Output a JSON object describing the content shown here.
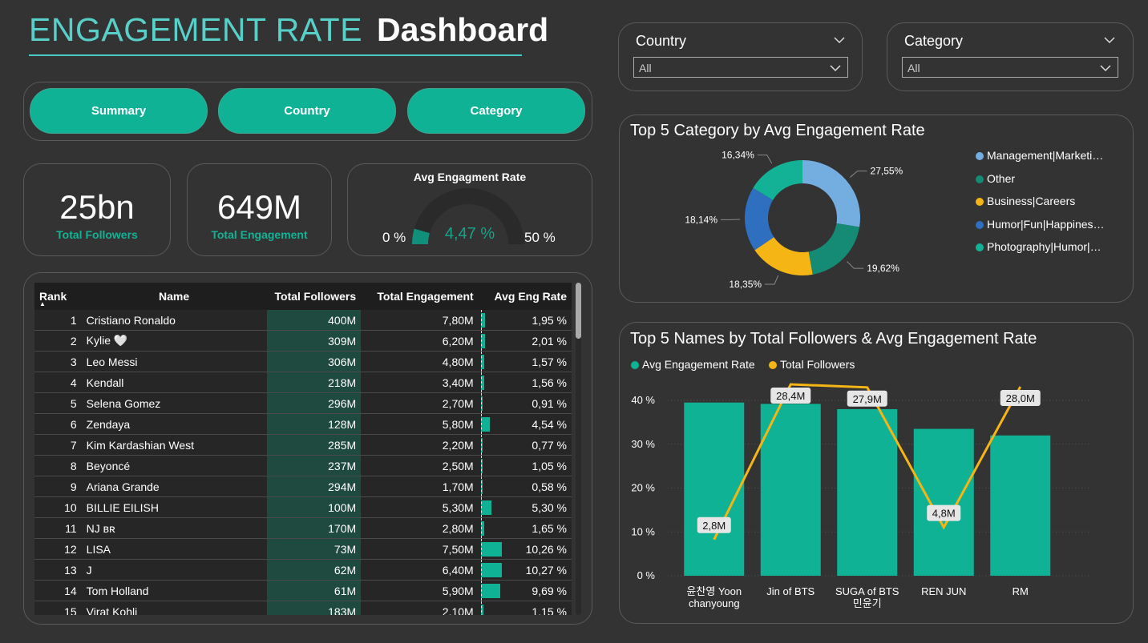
{
  "header": {
    "title_light": "ENGAGEMENT RATE",
    "title_bold": "Dashboard"
  },
  "nav": {
    "summary": "Summary",
    "country": "Country",
    "category": "Category"
  },
  "kpis": {
    "followers_value": "25bn",
    "followers_label": "Total Followers",
    "engagement_value": "649M",
    "engagement_label": "Total Engagement"
  },
  "gauge": {
    "title": "Avg Engagment Rate",
    "min_label": "0 %",
    "max_label": "50 %",
    "value_label": "4,47 %",
    "fraction": 0.0894
  },
  "slicers": {
    "country": {
      "label": "Country",
      "value": "All"
    },
    "category": {
      "label": "Category",
      "value": "All"
    }
  },
  "table": {
    "headers": {
      "rank": "Rank",
      "name": "Name",
      "followers": "Total Followers",
      "engagement": "Total Engagement",
      "avg": "Avg Eng Rate"
    },
    "rows": [
      {
        "rank": "1",
        "name": "Cristiano Ronaldo",
        "followers": "400M",
        "engagement": "7,80M",
        "avg": "1,95 %",
        "v": 1.95
      },
      {
        "rank": "2",
        "name": "Kylie 🤍",
        "followers": "309M",
        "engagement": "6,20M",
        "avg": "2,01 %",
        "v": 2.01
      },
      {
        "rank": "3",
        "name": "Leo Messi",
        "followers": "306M",
        "engagement": "4,80M",
        "avg": "1,57 %",
        "v": 1.57
      },
      {
        "rank": "4",
        "name": "Kendall",
        "followers": "218M",
        "engagement": "3,40M",
        "avg": "1,56 %",
        "v": 1.56
      },
      {
        "rank": "5",
        "name": "Selena Gomez",
        "followers": "296M",
        "engagement": "2,70M",
        "avg": "0,91 %",
        "v": 0.91
      },
      {
        "rank": "6",
        "name": "Zendaya",
        "followers": "128M",
        "engagement": "5,80M",
        "avg": "4,54 %",
        "v": 4.54
      },
      {
        "rank": "7",
        "name": "Kim Kardashian West",
        "followers": "285M",
        "engagement": "2,20M",
        "avg": "0,77 %",
        "v": 0.77
      },
      {
        "rank": "8",
        "name": "Beyoncé",
        "followers": "237M",
        "engagement": "2,50M",
        "avg": "1,05 %",
        "v": 1.05
      },
      {
        "rank": "9",
        "name": "Ariana Grande",
        "followers": "294M",
        "engagement": "1,70M",
        "avg": "0,58 %",
        "v": 0.58
      },
      {
        "rank": "10",
        "name": "BILLIE EILISH",
        "followers": "100M",
        "engagement": "5,30M",
        "avg": "5,30 %",
        "v": 5.3
      },
      {
        "rank": "11",
        "name": "NJ ʙʀ",
        "followers": "170M",
        "engagement": "2,80M",
        "avg": "1,65 %",
        "v": 1.65
      },
      {
        "rank": "12",
        "name": "LISA",
        "followers": "73M",
        "engagement": "7,50M",
        "avg": "10,26 %",
        "v": 10.26
      },
      {
        "rank": "13",
        "name": "J",
        "followers": "62M",
        "engagement": "6,40M",
        "avg": "10,27 %",
        "v": 10.27
      },
      {
        "rank": "14",
        "name": "Tom Holland",
        "followers": "61M",
        "engagement": "5,90M",
        "avg": "9,69 %",
        "v": 9.69
      },
      {
        "rank": "15",
        "name": "Virat Kohli",
        "followers": "183M",
        "engagement": "2,10M",
        "avg": "1,15 %",
        "v": 1.15
      }
    ]
  },
  "donut_title": "Top 5 Category by Avg Engagement Rate",
  "combo_title": "Top 5 Names by Total Followers & Avg Engagement Rate",
  "chart_data": [
    {
      "type": "pie",
      "title": "Top 5 Category by Avg Engagement Rate",
      "categories": [
        "Management|Marketi…",
        "Other",
        "Business|Careers",
        "Humor|Fun|Happines…",
        "Photography|Humor|…"
      ],
      "values": [
        27.55,
        19.62,
        18.35,
        18.14,
        16.34
      ],
      "labels": [
        "27,55%",
        "19,62%",
        "18,35%",
        "18,14%",
        "16,34%"
      ],
      "colors": [
        "#74aee0",
        "#158a74",
        "#f5b515",
        "#2f6fc0",
        "#13b296"
      ],
      "legend": "right"
    },
    {
      "type": "bar",
      "title": "Top 5 Names by Total Followers & Avg Engagement Rate",
      "categories": [
        "윤찬영 Yoon chanyoung",
        "Jin of BTS",
        "SUGA of BTS 민윤기",
        "REN JUN",
        "RM"
      ],
      "series": [
        {
          "name": "Avg Engagement Rate",
          "values": [
            39.5,
            39.2,
            38.0,
            33.5,
            32.0
          ],
          "color": "#10b295"
        },
        {
          "name": "Total Followers",
          "values": [
            2.8,
            28.4,
            27.9,
            4.8,
            28.0
          ],
          "value_labels": [
            "2,8M",
            "28,4M",
            "27,9M",
            "4,8M",
            "28,0M"
          ],
          "color": "#f5b515"
        }
      ],
      "yticks": [
        "40 %",
        "30 %",
        "20 %",
        "10 %",
        "0 %"
      ],
      "ylim": [
        0,
        40
      ],
      "legend": "top-left"
    }
  ]
}
